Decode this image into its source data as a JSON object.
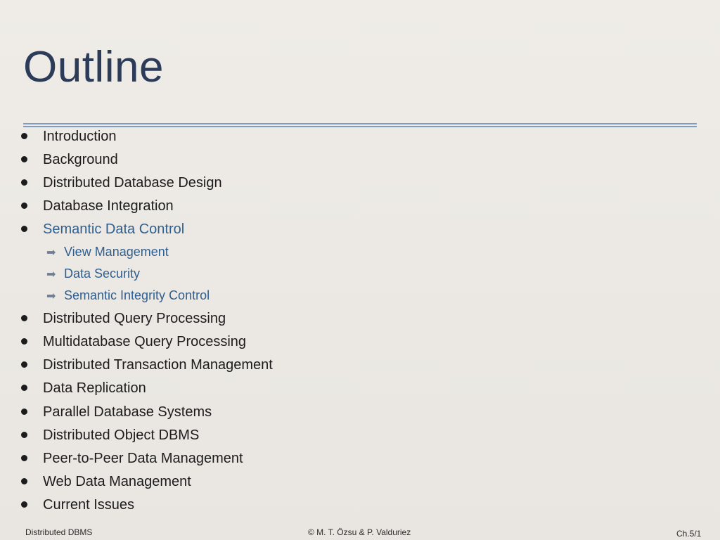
{
  "slide": {
    "title": "Outline",
    "items_top": [
      {
        "label": "Introduction"
      },
      {
        "label": "Background"
      },
      {
        "label": "Distributed Database Design"
      },
      {
        "label": "Database Integration"
      },
      {
        "label": "Semantic Data Control",
        "active": true
      }
    ],
    "subitems": [
      {
        "label": "View Management"
      },
      {
        "label": "Data Security"
      },
      {
        "label": "Semantic Integrity Control"
      }
    ],
    "items_bottom": [
      {
        "label": "Distributed Query Processing"
      },
      {
        "label": "Multidatabase Query Processing"
      },
      {
        "label": "Distributed Transaction Management"
      },
      {
        "label": "Data Replication"
      },
      {
        "label": "Parallel Database Systems"
      },
      {
        "label": "Distributed Object DBMS"
      },
      {
        "label": "Peer-to-Peer Data Management"
      },
      {
        "label": "Web Data Management"
      },
      {
        "label": "Current Issues"
      }
    ],
    "arrow_glyph": "➡",
    "bullet_glyph": "•"
  },
  "footer": {
    "left": "Distributed DBMS",
    "center": "© M. T. Özsu & P. Valduriez",
    "right": "Ch.5/1"
  },
  "colors": {
    "title": "#2b3b58",
    "accent_rule": "#7f9cc4",
    "active_text": "#2f5f8f"
  }
}
